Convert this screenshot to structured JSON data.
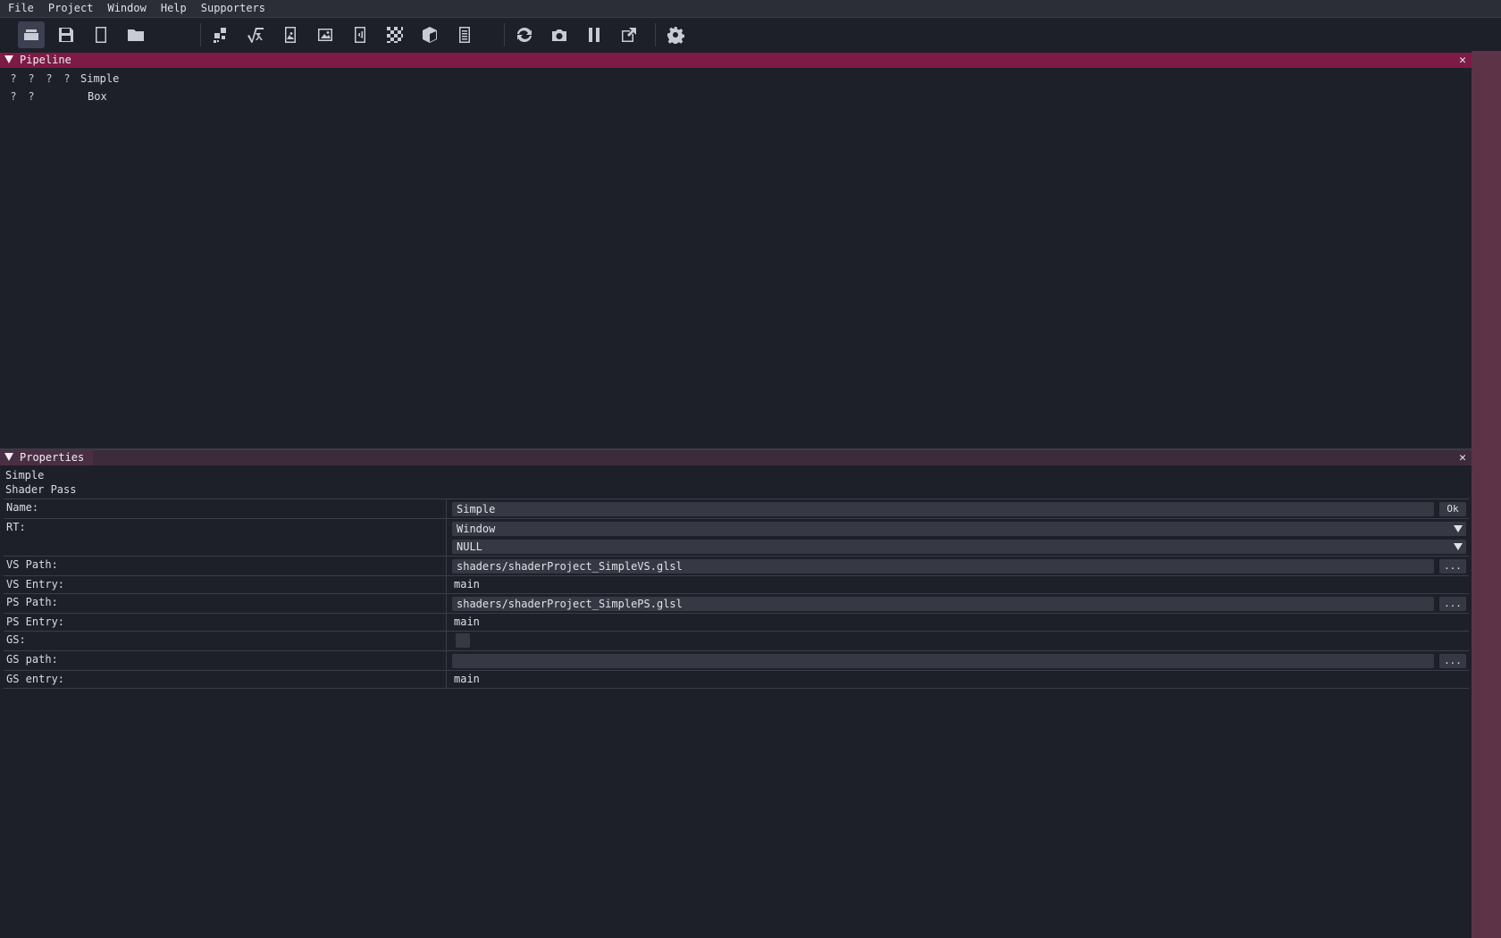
{
  "menu": [
    "File",
    "Project",
    "Window",
    "Help",
    "Supporters"
  ],
  "toolbar": {
    "icons": [
      "project-icon",
      "save-icon",
      "new-file-icon",
      "open-folder-icon",
      "shader-pass-icon",
      "sqrt-variable-icon",
      "texture-icon",
      "image-icon",
      "audio-icon",
      "checkerboard-icon",
      "cube-icon",
      "buffer-icon",
      "reload-icon",
      "camera-icon",
      "pause-icon",
      "popout-icon",
      "settings-icon"
    ]
  },
  "pipeline": {
    "title": "Pipeline",
    "close": "✕",
    "items": [
      {
        "markers": [
          "?",
          "?",
          "?",
          "?"
        ],
        "label": "Simple"
      },
      {
        "markers": [
          "?",
          "?"
        ],
        "label": "Box"
      }
    ]
  },
  "properties": {
    "title": "Properties",
    "close": "✕",
    "object_name": "Simple",
    "object_type": "Shader Pass",
    "rows": {
      "name": {
        "label": "Name:",
        "value": "Simple",
        "button": "Ok"
      },
      "rt": {
        "label": "RT:",
        "value1": "Window",
        "value2": "NULL"
      },
      "vs_path": {
        "label": "VS Path:",
        "value": "shaders/shaderProject_SimpleVS.glsl",
        "button": "..."
      },
      "vs_entry": {
        "label": "VS Entry:",
        "value": "main"
      },
      "ps_path": {
        "label": "PS Path:",
        "value": "shaders/shaderProject_SimplePS.glsl",
        "button": "..."
      },
      "ps_entry": {
        "label": "PS Entry:",
        "value": "main"
      },
      "gs": {
        "label": "GS:",
        "checked": false
      },
      "gs_path": {
        "label": "GS path:",
        "value": "",
        "button": "..."
      },
      "gs_entry": {
        "label": "GS entry:",
        "value": "main"
      }
    }
  }
}
